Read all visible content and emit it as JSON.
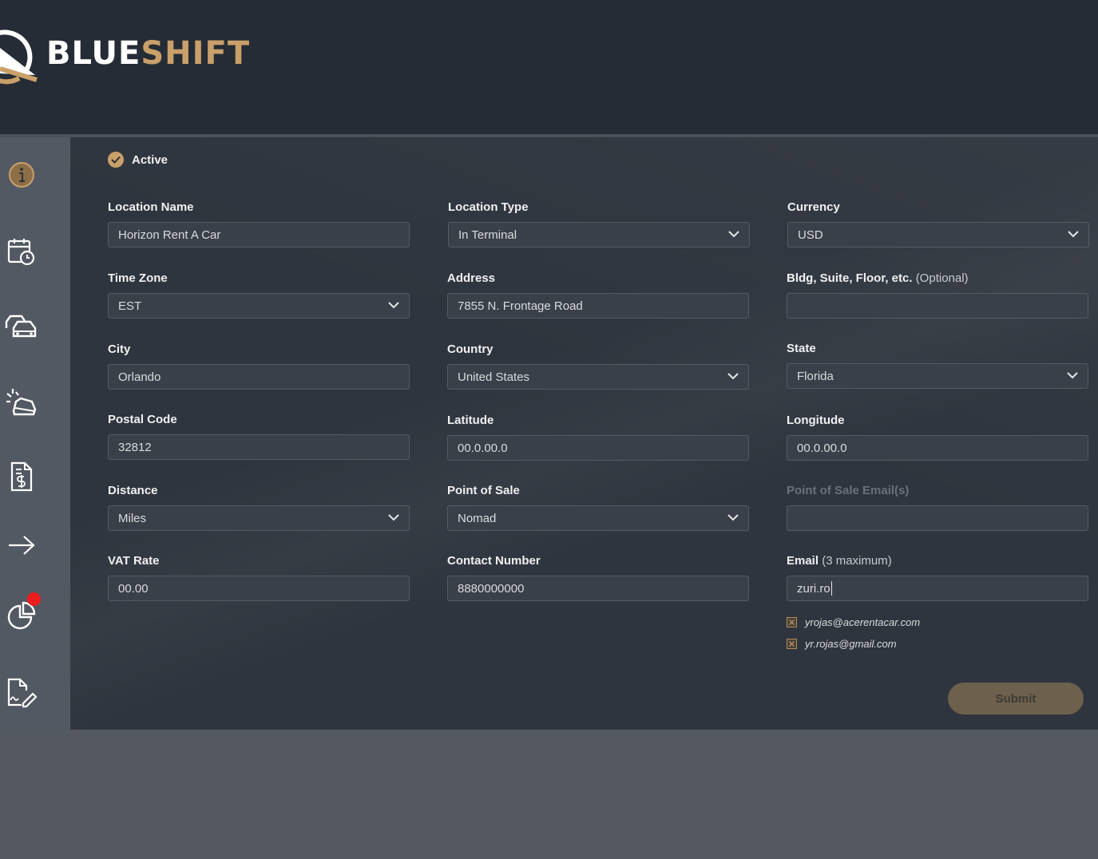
{
  "brand": {
    "name_part1": "BLUE",
    "name_part2": "SHIFT",
    "accent_color": "#c9a06a"
  },
  "sidebar": {
    "items": [
      {
        "icon": "info-icon"
      },
      {
        "icon": "calendar-clock-icon"
      },
      {
        "icon": "cars-icon"
      },
      {
        "icon": "car-cleaning-icon"
      },
      {
        "icon": "invoice-dollar-icon"
      },
      {
        "icon": "arrow-right-icon"
      },
      {
        "icon": "pie-chart-icon",
        "has_notification": true
      },
      {
        "icon": "document-signature-icon"
      }
    ]
  },
  "form": {
    "active": {
      "label": "Active",
      "checked": true
    },
    "location_name": {
      "label": "Location Name",
      "value": "Horizon Rent A Car"
    },
    "location_type": {
      "label": "Location Type",
      "value": "In Terminal"
    },
    "currency": {
      "label": "Currency",
      "value": "USD"
    },
    "time_zone": {
      "label": "Time Zone",
      "value": "EST"
    },
    "address": {
      "label": "Address",
      "value": "7855 N. Frontage Road"
    },
    "bldg": {
      "label": "Bldg, Suite, Floor, etc.",
      "label_suffix": "(Optional)",
      "value": ""
    },
    "city": {
      "label": "City",
      "value": "Orlando"
    },
    "country": {
      "label": "Country",
      "value": "United States"
    },
    "state": {
      "label": "State",
      "value": "Florida"
    },
    "postal_code": {
      "label": "Postal Code",
      "value": "32812"
    },
    "latitude": {
      "label": "Latitude",
      "value": "00.0.00.0"
    },
    "longitude": {
      "label": "Longitude",
      "value": "00.0.00.0"
    },
    "distance": {
      "label": "Distance",
      "value": "Miles"
    },
    "point_of_sale": {
      "label": "Point of Sale",
      "value": "Nomad"
    },
    "pos_emails": {
      "label": "Point of Sale Email(s)",
      "value": ""
    },
    "vat_rate": {
      "label": "VAT Rate",
      "value": "00.00"
    },
    "contact_number": {
      "label": "Contact Number",
      "value": "8880000000"
    },
    "email": {
      "label": "Email",
      "label_suffix": "(3 maximum)",
      "value": "zuri.ro"
    },
    "email_list": [
      "yrojas@acerentacar.com",
      "yr.rojas@gmail.com"
    ],
    "submit_label": "Submit"
  }
}
